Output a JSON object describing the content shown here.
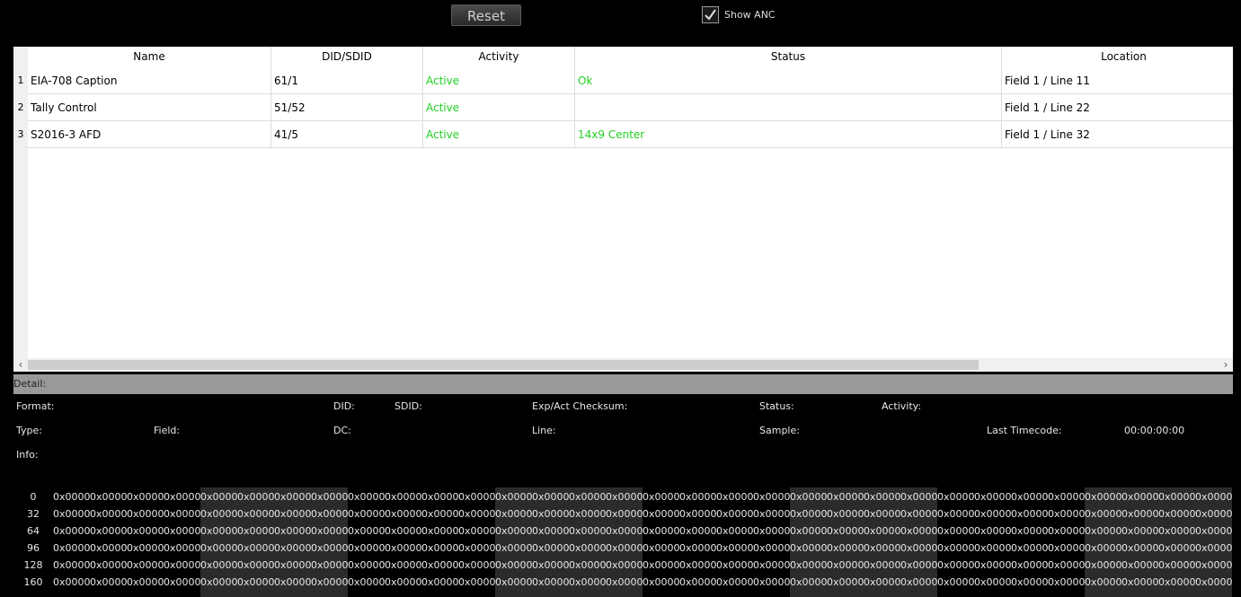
{
  "toolbar": {
    "reset_label": "Reset",
    "show_anc_label": "Show ANC",
    "show_anc_checked": true
  },
  "table": {
    "columns": [
      "Name",
      "DID/SDID",
      "Activity",
      "Status",
      "Location"
    ],
    "rows": [
      {
        "num": "1",
        "name": "EIA-708 Caption",
        "did": "61/1",
        "activity": "Active",
        "status": "Ok",
        "location": "Field 1 / Line 11"
      },
      {
        "num": "2",
        "name": "Tally Control",
        "did": "51/52",
        "activity": "Active",
        "status": "",
        "location": "Field 1 / Line 22"
      },
      {
        "num": "3",
        "name": "S2016-3 AFD",
        "did": "41/5",
        "activity": "Active",
        "status": "14x9 Center",
        "location": "Field 1 / Line 32"
      }
    ]
  },
  "detail": {
    "header": "Detail:",
    "format_label": "Format:",
    "did_label": "DID:",
    "sdid_label": "SDID:",
    "checksum_label": "Exp/Act Checksum:",
    "status_label": "Status:",
    "activity_label": "Activity:",
    "type_label": "Type:",
    "field_label": "Field:",
    "dc_label": "DC:",
    "line_label": "Line:",
    "sample_label": "Sample:",
    "last_timecode_label": "Last Timecode:",
    "last_timecode_value": "00:00:00:00",
    "info_label": "Info:"
  },
  "hex": {
    "row_labels": [
      "0",
      "32",
      "64",
      "96",
      "128",
      "160"
    ],
    "cell_value": "0x0000",
    "cols": 32
  },
  "colors": {
    "active_green": "#22d022",
    "background": "#000000"
  }
}
